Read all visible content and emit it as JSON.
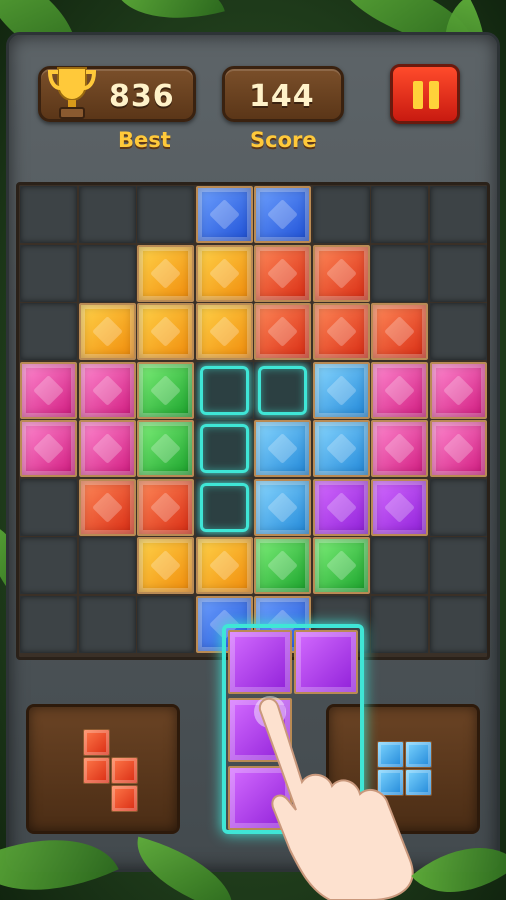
{
  "header": {
    "best_value": "836",
    "best_label": "Best",
    "score_value": "144",
    "score_label": "Score"
  },
  "colors": {
    "blue": "#2f6ef0",
    "orange": "#ffa21a",
    "red": "#f2461e",
    "pink": "#f0389e",
    "green": "#2fc43a",
    "cyan": "#2fa6f0",
    "purple": "#a22ef0",
    "highlight": "#3fe6d6"
  },
  "board": {
    "rows": 8,
    "cols": 8,
    "grid": [
      [
        null,
        null,
        null,
        "blue",
        "blue",
        null,
        null,
        null
      ],
      [
        null,
        null,
        "orange",
        "orange",
        "red",
        "red",
        null,
        null
      ],
      [
        null,
        "orange",
        "orange",
        "orange",
        "red",
        "red",
        "red",
        null
      ],
      [
        "pink",
        "pink",
        "green",
        "slot",
        "slot",
        "cyan",
        "pink",
        "pink"
      ],
      [
        "pink",
        "pink",
        "green",
        "slot",
        "cyan",
        "cyan",
        "pink",
        "pink"
      ],
      [
        null,
        "red",
        "red",
        "slot",
        "cyan",
        "purple",
        "purple",
        null
      ],
      [
        null,
        null,
        "orange",
        "orange",
        "green",
        "green",
        null,
        null
      ],
      [
        null,
        null,
        null,
        "blue",
        "blue",
        null,
        null,
        null
      ]
    ]
  },
  "trays": {
    "left_piece_color": "red",
    "right_piece_color": "cyan",
    "dragging_piece_color": "purple"
  }
}
